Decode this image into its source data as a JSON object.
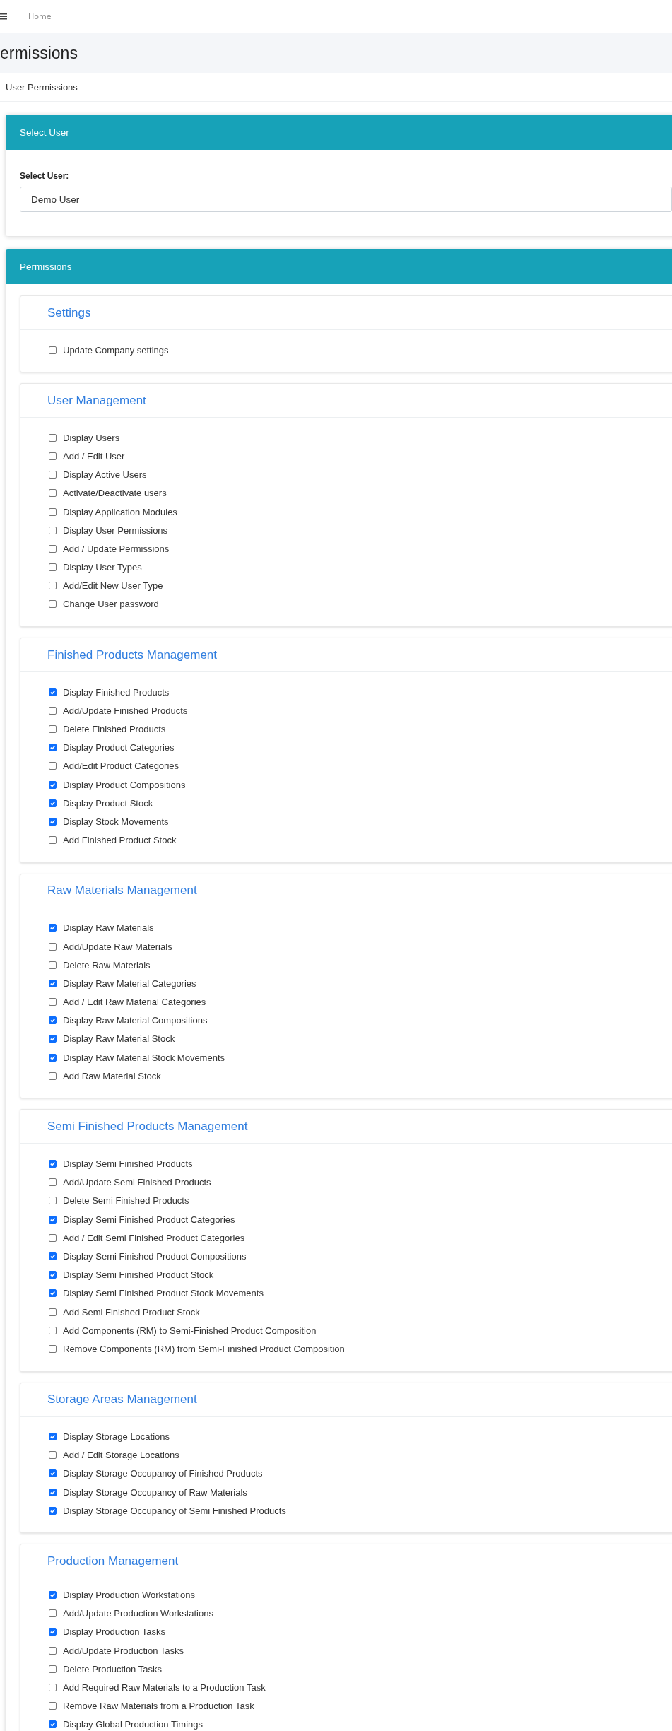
{
  "topbar": {
    "breadcrumb": "Home"
  },
  "page_title": "ermissions",
  "subtitle": "User Permissions",
  "select_card": {
    "header": "Select User",
    "label": "Select User:",
    "value": "Demo User"
  },
  "permissions_card": {
    "header": "Permissions"
  },
  "groups": [
    {
      "title": "Settings",
      "items": [
        {
          "label": "Update Company settings",
          "checked": false
        }
      ]
    },
    {
      "title": "User Management",
      "items": [
        {
          "label": "Display Users",
          "checked": false
        },
        {
          "label": "Add / Edit User",
          "checked": false
        },
        {
          "label": "Display Active Users",
          "checked": false
        },
        {
          "label": "Activate/Deactivate users",
          "checked": false
        },
        {
          "label": "Display Application Modules",
          "checked": false
        },
        {
          "label": "Display User Permissions",
          "checked": false
        },
        {
          "label": "Add / Update Permissions",
          "checked": false
        },
        {
          "label": "Display User Types",
          "checked": false
        },
        {
          "label": "Add/Edit New User Type",
          "checked": false
        },
        {
          "label": "Change User password",
          "checked": false
        }
      ]
    },
    {
      "title": "Finished Products Management",
      "items": [
        {
          "label": "Display Finished Products",
          "checked": true
        },
        {
          "label": "Add/Update Finished Products",
          "checked": false
        },
        {
          "label": "Delete Finished Products",
          "checked": false
        },
        {
          "label": "Display Product Categories",
          "checked": true
        },
        {
          "label": "Add/Edit Product Categories",
          "checked": false
        },
        {
          "label": "Display Product Compositions",
          "checked": true
        },
        {
          "label": "Display Product Stock",
          "checked": true
        },
        {
          "label": "Display Stock Movements",
          "checked": true
        },
        {
          "label": "Add Finished Product Stock",
          "checked": false
        }
      ]
    },
    {
      "title": "Raw Materials Management",
      "items": [
        {
          "label": "Display Raw Materials",
          "checked": true
        },
        {
          "label": "Add/Update Raw Materials",
          "checked": false
        },
        {
          "label": "Delete Raw Materials",
          "checked": false
        },
        {
          "label": "Display Raw Material Categories",
          "checked": true
        },
        {
          "label": "Add / Edit Raw Material Categories",
          "checked": false
        },
        {
          "label": "Display Raw Material Compositions",
          "checked": true
        },
        {
          "label": "Display Raw Material Stock",
          "checked": true
        },
        {
          "label": "Display Raw Material Stock Movements",
          "checked": true
        },
        {
          "label": "Add Raw Material Stock",
          "checked": false
        }
      ]
    },
    {
      "title": "Semi Finished Products Management",
      "items": [
        {
          "label": "Display Semi Finished Products",
          "checked": true
        },
        {
          "label": "Add/Update Semi Finished Products",
          "checked": false
        },
        {
          "label": "Delete Semi Finished Products",
          "checked": false
        },
        {
          "label": "Display Semi Finished Product Categories",
          "checked": true
        },
        {
          "label": "Add / Edit Semi Finished Product Categories",
          "checked": false
        },
        {
          "label": "Display Semi Finished Product Compositions",
          "checked": true
        },
        {
          "label": "Display Semi Finished Product Stock",
          "checked": true
        },
        {
          "label": "Display Semi Finished Product Stock Movements",
          "checked": true
        },
        {
          "label": "Add Semi Finished Product Stock",
          "checked": false
        },
        {
          "label": "Add Components (RM) to Semi-Finished Product Composition",
          "checked": false
        },
        {
          "label": "Remove Components (RM) from Semi-Finished Product Composition",
          "checked": false
        }
      ]
    },
    {
      "title": "Storage Areas Management",
      "items": [
        {
          "label": "Display Storage Locations",
          "checked": true
        },
        {
          "label": "Add / Edit Storage Locations",
          "checked": false
        },
        {
          "label": "Display Storage Occupancy of Finished Products",
          "checked": true
        },
        {
          "label": "Display Storage Occupancy of Raw Materials",
          "checked": true
        },
        {
          "label": "Display Storage Occupancy of Semi Finished Products",
          "checked": true
        }
      ]
    },
    {
      "title": "Production Management",
      "items": [
        {
          "label": "Display Production Workstations",
          "checked": true
        },
        {
          "label": "Add/Update Production Workstations",
          "checked": false
        },
        {
          "label": "Display Production Tasks",
          "checked": true
        },
        {
          "label": "Add/Update Production Tasks",
          "checked": false
        },
        {
          "label": "Delete Production Tasks",
          "checked": false
        },
        {
          "label": "Add Required Raw Materials to a Production Task",
          "checked": false
        },
        {
          "label": "Remove Raw Materials from a Production Task",
          "checked": false
        },
        {
          "label": "Display Global Production Timings",
          "checked": true
        }
      ]
    }
  ]
}
